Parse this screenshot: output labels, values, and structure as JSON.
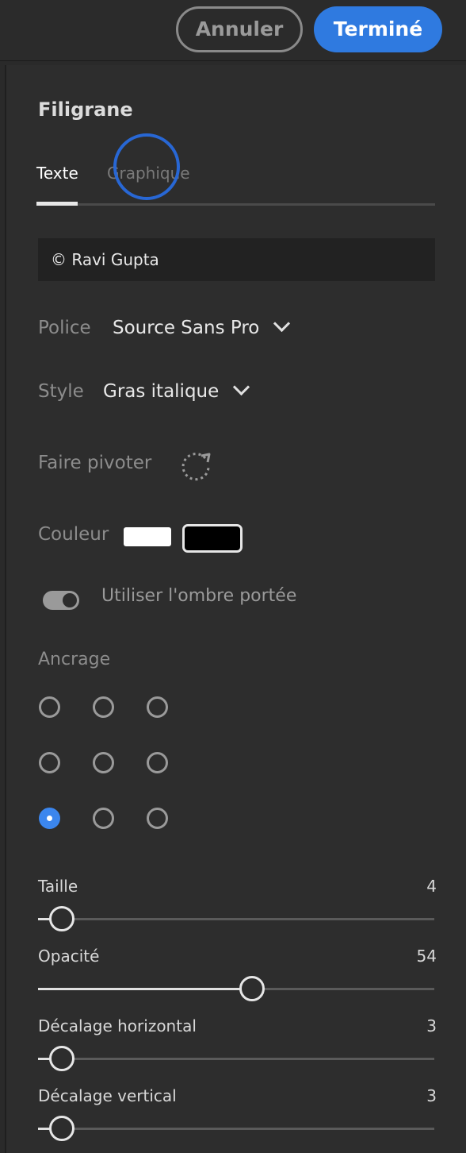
{
  "header": {
    "cancel_label": "Annuler",
    "done_label": "Terminé",
    "done_color": "#2f7ae0"
  },
  "panel": {
    "title": "Filigrane",
    "tabs": [
      {
        "label": "Texte",
        "active": true
      },
      {
        "label": "Graphique",
        "active": false
      }
    ],
    "watermark_text": "© Ravi Gupta",
    "font": {
      "label": "Police",
      "value": "Source Sans Pro"
    },
    "style": {
      "label": "Style",
      "value": "Gras italique"
    },
    "rotate": {
      "label": "Faire pivoter",
      "icon": "rotate-icon"
    },
    "color": {
      "label": "Couleur",
      "swatches": [
        "#ffffff",
        "#000000"
      ],
      "selected": 1
    },
    "shadow": {
      "label": "Utiliser l'ombre portée",
      "enabled": true
    },
    "anchor": {
      "label": "Ancrage",
      "selected_row": 2,
      "selected_col": 0
    },
    "sliders": [
      {
        "key": "size",
        "label": "Taille",
        "value": "4",
        "fraction": 0.06
      },
      {
        "key": "opacity",
        "label": "Opacité",
        "value": "54",
        "fraction": 0.54
      },
      {
        "key": "offset-h",
        "label": "Décalage horizontal",
        "value": "3",
        "fraction": 0.06
      },
      {
        "key": "offset-v",
        "label": "Décalage vertical",
        "value": "3",
        "fraction": 0.06
      }
    ]
  }
}
